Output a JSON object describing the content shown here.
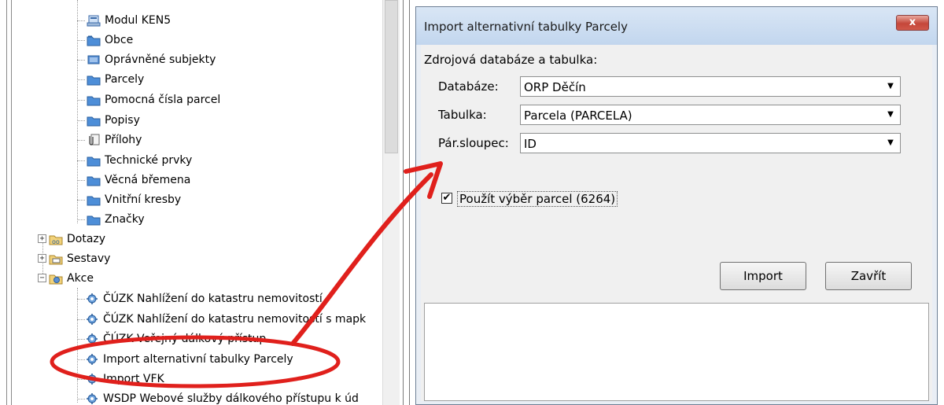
{
  "tree": {
    "items": [
      {
        "label": "Modul KEN5",
        "icon": "module-icon"
      },
      {
        "label": "Obce",
        "icon": "folder-icon"
      },
      {
        "label": "Oprávněné subjekty",
        "icon": "table-icon"
      },
      {
        "label": "Parcely",
        "icon": "folder-icon"
      },
      {
        "label": "Pomocná čísla parcel",
        "icon": "folder-icon"
      },
      {
        "label": "Popisy",
        "icon": "folder-icon"
      },
      {
        "label": "Přílohy",
        "icon": "attachment-icon"
      },
      {
        "label": "Technické prvky",
        "icon": "folder-icon"
      },
      {
        "label": "Věcná břemena",
        "icon": "folder-icon"
      },
      {
        "label": "Vnitřní kresby",
        "icon": "folder-icon"
      },
      {
        "label": "Značky",
        "icon": "folder-icon"
      }
    ],
    "groups": [
      {
        "label": "Dotazy",
        "expander": "+",
        "icon": "query-folder-icon"
      },
      {
        "label": "Sestavy",
        "expander": "+",
        "icon": "report-folder-icon"
      },
      {
        "label": "Akce",
        "expander": "−",
        "icon": "action-folder-icon"
      }
    ],
    "actions": [
      {
        "label": "ČÚZK Nahlížení do katastru nemovitostí"
      },
      {
        "label": "ČÚZK Nahlížení do katastru nemovitostí s mapk"
      },
      {
        "label": "ČÚZK Veřejný dálkový přístup"
      },
      {
        "label": "Import alternativní tabulky Parcely"
      },
      {
        "label": "Import VFK"
      },
      {
        "label": "WSDP Webové služby dálkového přístupu k úd"
      }
    ]
  },
  "dialog": {
    "title": "Import alternativní tabulky Parcely",
    "close_label": "x",
    "source_heading": "Zdrojová databáze a tabulka:",
    "database_label": "Databáze:",
    "database_value": "ORP Děčín",
    "table_label": "Tabulka:",
    "table_value": "Parcela (PARCELA)",
    "pair_column_label": "Pár.sloupec:",
    "pair_column_value": "ID",
    "use_selection_label": "Použít výběr parcel (6264)",
    "use_selection_checked": true,
    "import_button": "Import",
    "close_button": "Zavřít"
  },
  "colors": {
    "annotation_red": "#e0201c",
    "dialog_title_bar": "#c9dbf0",
    "close_button": "#c5473a"
  }
}
